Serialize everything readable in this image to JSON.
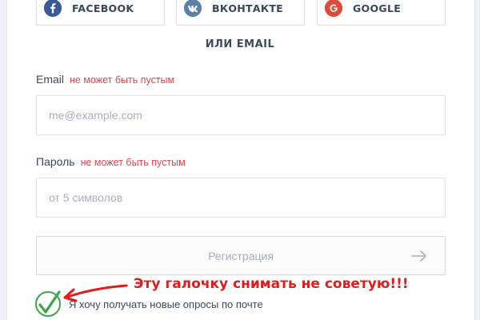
{
  "social": {
    "facebook": {
      "label": "FACEBOOK",
      "icon": "facebook-icon",
      "color": "#3b5998"
    },
    "vkontakte": {
      "label": "ВКОНТАКТЕ",
      "icon": "vk-icon",
      "color": "#5b7fa6"
    },
    "google": {
      "label": "GOOGLE",
      "icon": "google-icon",
      "color": "#dd4b39"
    }
  },
  "divider": {
    "text": "ИЛИ EMAIL"
  },
  "form": {
    "email": {
      "label": "Email",
      "error": "не может быть пустым",
      "placeholder": "me@example.com",
      "value": ""
    },
    "password": {
      "label": "Пароль",
      "error": "не может быть пустым",
      "placeholder": "от 5 символов",
      "value": ""
    },
    "submit": {
      "label": "Регистрация",
      "icon": "arrow-right-icon"
    },
    "newsletter": {
      "label": "Я хочу получать новые опросы по почте",
      "checked": true
    }
  },
  "annotation": {
    "text": "Эту галочку снимать не советую!!!",
    "color": "#e31b1b"
  },
  "colors": {
    "error": "#e8434a",
    "check": "#3aa84a",
    "text": "#3c4a5b"
  }
}
